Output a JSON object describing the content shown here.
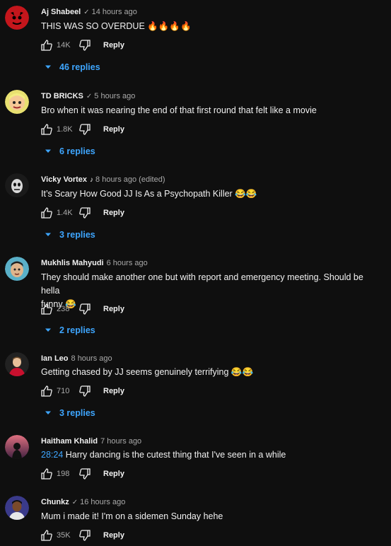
{
  "comments": [
    {
      "author": "Aj Shabeel",
      "verified": true,
      "time": "14 hours ago",
      "text": "THIS WAS SO OVERDUE 🔥🔥🔥🔥",
      "likes": "14K",
      "reply_label": "Reply",
      "replies": "46 replies",
      "avatar_color": "#c4161c"
    },
    {
      "author": "TD BRICKS",
      "verified": true,
      "time": "5 hours ago",
      "text": "Bro when it was nearing the end of that first round that felt like a movie",
      "likes": "1.8K",
      "reply_label": "Reply",
      "replies": "6 replies",
      "avatar_color": "#e8e070"
    },
    {
      "author": "Vicky Vortex",
      "verified": false,
      "music": "♪",
      "time": "8 hours ago (edited)",
      "text": "It’s Scary How Good JJ Is As a Psychopath Killer 😂😂",
      "likes": "1.4K",
      "reply_label": "Reply",
      "replies": "3 replies",
      "avatar_color": "#1a1a1a"
    },
    {
      "author": "Mukhlis Mahyudi",
      "verified": false,
      "time": "6 hours ago",
      "text_line1": "They should make another one but with report and emergency meeting. Should be hella",
      "text_line2": "funny 😂",
      "likes": "238",
      "reply_label": "Reply",
      "replies": "2 replies",
      "avatar_color": "#5ab0c8"
    },
    {
      "author": "Ian Leo",
      "verified": false,
      "time": "8 hours ago",
      "text": "Getting chased by JJ seems genuinely terrifying 😂😂",
      "likes": "710",
      "reply_label": "Reply",
      "replies": "3 replies",
      "avatar_color": "#c8102e"
    },
    {
      "author": "Haitham Khalid",
      "verified": false,
      "time": "7 hours ago",
      "timestamp": "28:24",
      "text": " Harry dancing is the cutest thing that I've seen in a while",
      "likes": "198",
      "reply_label": "Reply",
      "avatar_color": "#d65a6a"
    },
    {
      "author": "Chunkz",
      "verified": true,
      "time": "16 hours ago",
      "text": "Mum i made it! I'm on a sidemen Sunday hehe",
      "likes": "35K",
      "reply_label": "Reply",
      "avatar_color": "#3a3a8a"
    }
  ],
  "verified_glyph": "✓"
}
